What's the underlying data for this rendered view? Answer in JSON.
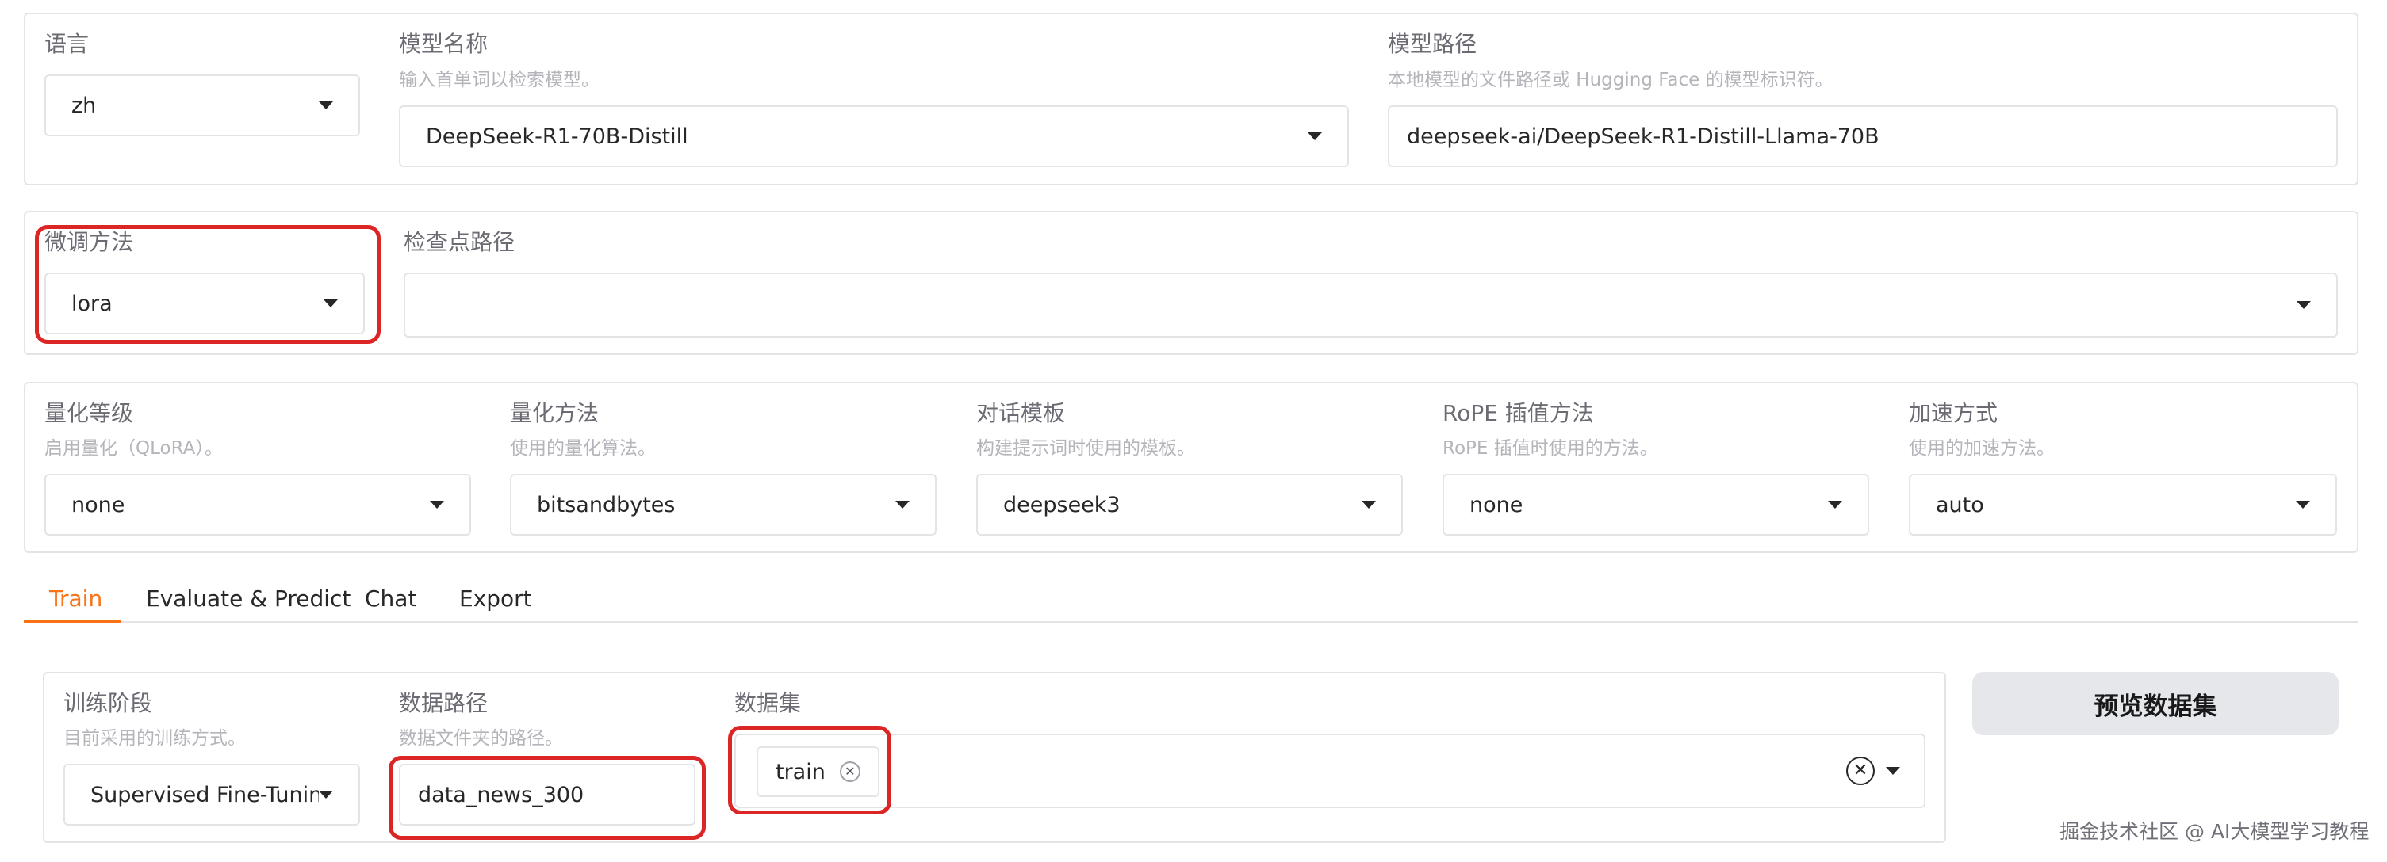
{
  "model_panel": {
    "lang_label": "语言",
    "lang_value": "zh",
    "model_name_label": "模型名称",
    "model_name_info": "输入首单词以检索模型。",
    "model_name_value": "DeepSeek-R1-70B-Distill",
    "model_path_label": "模型路径",
    "model_path_info": "本地模型的文件路径或 Hugging Face 的模型标识符。",
    "model_path_value": "deepseek-ai/DeepSeek-R1-Distill-Llama-70B"
  },
  "finetune_panel": {
    "method_label": "微调方法",
    "method_value": "lora",
    "checkpoint_label": "检查点路径",
    "checkpoint_value": ""
  },
  "advanced_panel": {
    "quant_bit_label": "量化等级",
    "quant_bit_info": "启用量化（QLoRA）。",
    "quant_bit_value": "none",
    "quant_method_label": "量化方法",
    "quant_method_info": "使用的量化算法。",
    "quant_method_value": "bitsandbytes",
    "template_label": "对话模板",
    "template_info": "构建提示词时使用的模板。",
    "template_value": "deepseek3",
    "rope_label": "RoPE 插值方法",
    "rope_info": "RoPE 插值时使用的方法。",
    "rope_value": "none",
    "booster_label": "加速方式",
    "booster_info": "使用的加速方法。",
    "booster_value": "auto"
  },
  "tabs": [
    "Train",
    "Evaluate & Predict",
    "Chat",
    "Export"
  ],
  "active_tab": "Train",
  "train": {
    "stage_label": "训练阶段",
    "stage_info": "目前采用的训练方式。",
    "stage_value": "Supervised Fine-Tuning",
    "dataset_dir_label": "数据路径",
    "dataset_dir_info": "数据文件夹的路径。",
    "dataset_dir_value": "data_news_300",
    "dataset_label": "数据集",
    "dataset_chips": [
      "train"
    ],
    "preview_button": "预览数据集"
  },
  "watermark": "掘金技术社区 @ AI大模型学习教程",
  "colors": {
    "accent": "#f97316",
    "highlight": "#dc2626"
  },
  "icons": [
    "dropdown-caret-icon",
    "chip-remove-icon",
    "clear-icon"
  ]
}
